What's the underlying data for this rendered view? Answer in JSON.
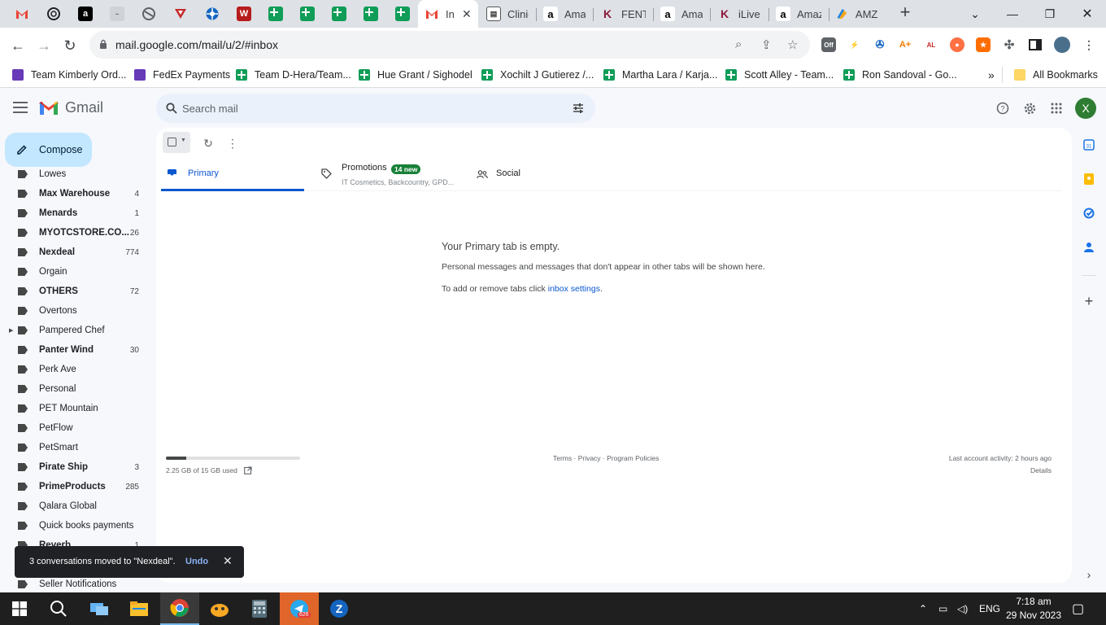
{
  "browser": {
    "tabs": [
      {
        "icon": "gmail-icon",
        "title": ""
      },
      {
        "icon": "chatgpt-icon",
        "title": ""
      },
      {
        "icon": "amazon-icon",
        "title": ""
      },
      {
        "icon": "ad-icon",
        "title": ""
      },
      {
        "icon": "globe-icon",
        "title": ""
      },
      {
        "icon": "shield-icon",
        "title": ""
      },
      {
        "icon": "wheel-icon",
        "title": ""
      },
      {
        "icon": "w-icon",
        "title": ""
      },
      {
        "icon": "sheets-icon",
        "title": ""
      },
      {
        "icon": "sheets-icon",
        "title": ""
      },
      {
        "icon": "sheets-icon",
        "title": ""
      },
      {
        "icon": "sheets-icon",
        "title": ""
      },
      {
        "icon": "sheets-icon",
        "title": ""
      },
      {
        "icon": "gmail-icon",
        "title": "In"
      },
      {
        "icon": "cliniq-icon",
        "title": "Cliniq"
      },
      {
        "icon": "amazon-icon",
        "title": "Amaz"
      },
      {
        "icon": "k-icon",
        "title": "FENTY"
      },
      {
        "icon": "amazon-icon",
        "title": "Amaz"
      },
      {
        "icon": "k-icon",
        "title": "iLive E"
      },
      {
        "icon": "amazon-icon",
        "title": "Amaz"
      },
      {
        "icon": "amz-icon",
        "title": "AMZ"
      }
    ],
    "url": "mail.google.com/mail/u/2/#inbox",
    "extension_badge": "Off",
    "bookmarks": [
      {
        "label": "Team Kimberly Ord..."
      },
      {
        "label": "FedEx Payments"
      },
      {
        "label": "Team D-Hera/Team..."
      },
      {
        "label": "Hue Grant / Sighodel"
      },
      {
        "label": "Xochilt J Gutierez /..."
      },
      {
        "label": "Martha Lara / Karja..."
      },
      {
        "label": "Scott Alley - Team..."
      },
      {
        "label": "Ron Sandoval - Go..."
      }
    ],
    "all_bookmarks": "All Bookmarks"
  },
  "gmail": {
    "product_name": "Gmail",
    "search_placeholder": "Search mail",
    "avatar_letter": "X",
    "compose_label": "Compose",
    "labels": [
      {
        "name": "Lowes",
        "count": "",
        "bold": false
      },
      {
        "name": "Max Warehouse",
        "count": "4",
        "bold": true
      },
      {
        "name": "Menards",
        "count": "1",
        "bold": true
      },
      {
        "name": "MYOTCSTORE.CO...",
        "count": "26",
        "bold": true
      },
      {
        "name": "Nexdeal",
        "count": "774",
        "bold": true
      },
      {
        "name": "Orgain",
        "count": "",
        "bold": false
      },
      {
        "name": "OTHERS",
        "count": "72",
        "bold": true
      },
      {
        "name": "Overtons",
        "count": "",
        "bold": false
      },
      {
        "name": "Pampered Chef",
        "count": "",
        "bold": false,
        "expandable": true
      },
      {
        "name": "Panter Wind",
        "count": "30",
        "bold": true
      },
      {
        "name": "Perk Ave",
        "count": "",
        "bold": false
      },
      {
        "name": "Personal",
        "count": "",
        "bold": false
      },
      {
        "name": "PET Mountain",
        "count": "",
        "bold": false
      },
      {
        "name": "PetFlow",
        "count": "",
        "bold": false
      },
      {
        "name": "PetSmart",
        "count": "",
        "bold": false
      },
      {
        "name": "Pirate Ship",
        "count": "3",
        "bold": true
      },
      {
        "name": "PrimeProducts",
        "count": "285",
        "bold": true
      },
      {
        "name": "Qalara Global",
        "count": "",
        "bold": false
      },
      {
        "name": "Quick books payments",
        "count": "",
        "bold": false
      },
      {
        "name": "Reverb",
        "count": "1",
        "bold": true
      },
      {
        "name": "",
        "count": "",
        "bold": false
      },
      {
        "name": "Seller Notifications",
        "count": "",
        "bold": false
      }
    ],
    "inbox_tabs": {
      "primary": "Primary",
      "promotions": "Promotions",
      "promotions_badge": "14 new",
      "promotions_senders": "IT Cosmetics, Backcountry, GPD...",
      "social": "Social"
    },
    "empty_state": {
      "title": "Your Primary tab is empty.",
      "line1": "Personal messages and messages that don't appear in other tabs will be shown here.",
      "line2_prefix": "To add or remove tabs click ",
      "line2_link": "inbox settings",
      "line2_suffix": "."
    },
    "footer": {
      "storage_text": "2.25 GB of 15 GB used",
      "storage_fraction": 0.15,
      "links": "Terms · Privacy · Program Policies",
      "last_activity": "Last account activity: 2 hours ago",
      "details": "Details"
    },
    "snackbar": {
      "message": "3 conversations moved to \"Nexdeal\".",
      "undo": "Undo"
    }
  },
  "taskbar": {
    "telegram_badge": "626",
    "language": "ENG",
    "time": "7:18 am",
    "date": "29 Nov 2023"
  },
  "colors": {
    "accent": "#0b57d0",
    "compose_bg": "#c2e7ff",
    "badge_green": "#188038"
  }
}
